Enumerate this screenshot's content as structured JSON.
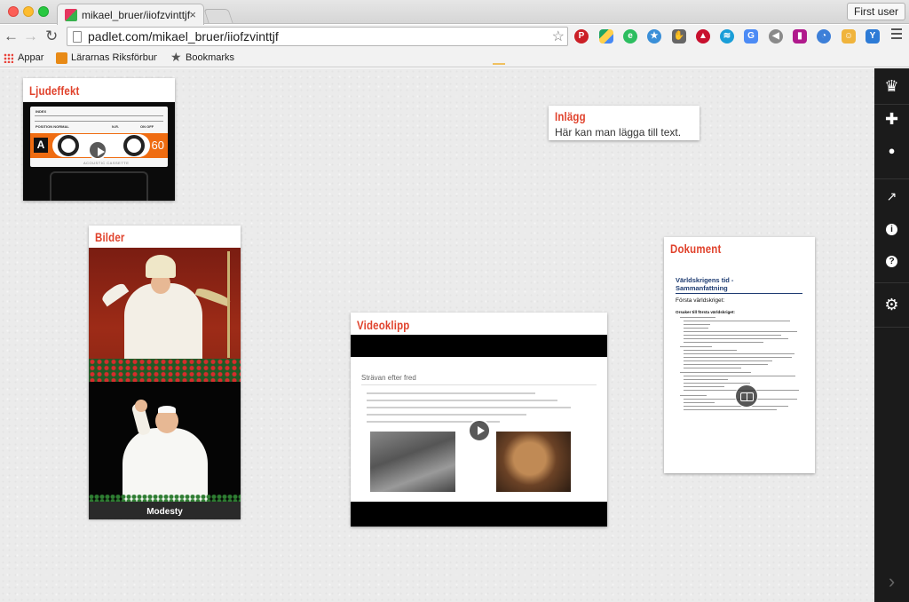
{
  "browser": {
    "tab_title": "mikael_bruer/iiofzvinttjf",
    "tab_close": "×",
    "user_button": "First user",
    "url": "padlet.com/mikael_bruer/iiofzvinttjf",
    "extensions": [
      "pinterest-icon",
      "google-drive-icon",
      "evernote-icon",
      "bookmark-star-icon",
      "puzzle-icon",
      "red-car-icon",
      "screencast-icon",
      "translate-icon",
      "audio-icon",
      "pink-extension-icon",
      "blue-circle-icon",
      "face-icon",
      "y-icon"
    ]
  },
  "bookmarks": {
    "apps": "Appar",
    "item1": "Lärarnas Riksförbund",
    "item2": "Bookmarks"
  },
  "posts": {
    "audio": {
      "title": "Ljudeffekt",
      "cassette": {
        "label": "A",
        "length": "60",
        "brand": "ACOUSTIC CASSETTE",
        "index": "INDEX",
        "position": "POSITION NORMAL",
        "nr": "N.R.",
        "mode": "ON  OFF"
      }
    },
    "text": {
      "title": "Inlägg",
      "body": "Här kan man lägga till text."
    },
    "images": {
      "title": "Bilder",
      "caption": "Modesty"
    },
    "video": {
      "title": "Videoklipp",
      "slide_title": "Strävan efter fred"
    },
    "document": {
      "title": "Dokument",
      "doc_title_1": "Världskrigens tid -",
      "doc_title_2": "Sammanfattning",
      "doc_sub": "Första världskriget:",
      "doc_bold": "Orsaker till första världskriget:"
    }
  },
  "sidebar": {
    "items": [
      {
        "name": "padlet-logo-icon",
        "glyph": "♛"
      },
      {
        "name": "add-post-icon",
        "glyph": "✚"
      },
      {
        "name": "profile-icon",
        "glyph": "●"
      },
      {
        "name": "share-icon",
        "glyph": "↗"
      },
      {
        "name": "info-icon",
        "glyph": "i"
      },
      {
        "name": "help-icon",
        "glyph": "?"
      },
      {
        "name": "settings-gear-icon",
        "glyph": "⚙"
      },
      {
        "name": "collapse-chevron-icon",
        "glyph": "›"
      }
    ]
  },
  "colors": {
    "accent": "#e0422c",
    "sidebar": "#1b1b1b",
    "canvas": "#ebebeb"
  }
}
